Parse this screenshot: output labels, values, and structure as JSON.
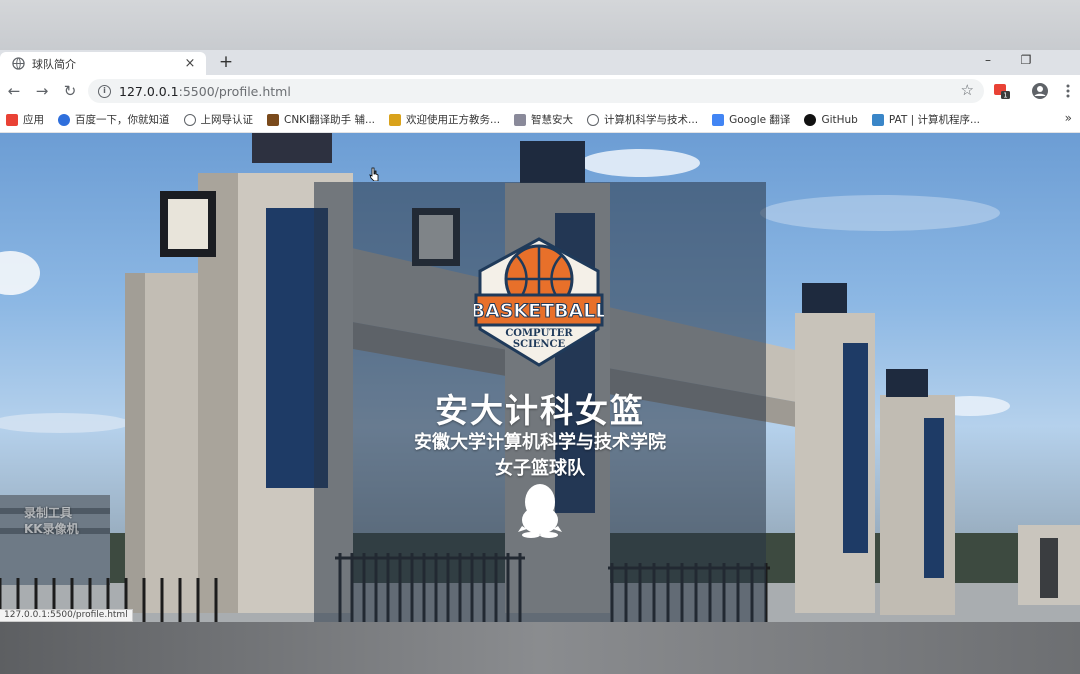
{
  "tab": {
    "title": "球队简介",
    "close": "×"
  },
  "newtab": "+",
  "window": {
    "minimize": "–",
    "restore": "❐"
  },
  "toolbar": {
    "back": "←",
    "forward": "→",
    "reload": "↻",
    "url_host": "127.0.0.1",
    "url_path": ":5500/profile.html",
    "star": "☆"
  },
  "bookmarks": [
    {
      "label": "应用",
      "icon": "apps-grid-icon",
      "color": "#e94235"
    },
    {
      "label": "百度一下，你就知道",
      "icon": "baidu-paw-icon",
      "color": "#2f6fdc"
    },
    {
      "label": "上网导认证",
      "icon": "globe-icon",
      "color": "#5f6368"
    },
    {
      "label": "CNKI翻译助手 辅...",
      "icon": "cnki-icon",
      "color": "#7a4a1c"
    },
    {
      "label": "欢迎使用正方教务...",
      "icon": "zf-icon",
      "color": "#d9a21b"
    },
    {
      "label": "智慧安大",
      "icon": "ahu-icon",
      "color": "#8a8a9a"
    },
    {
      "label": "计算机科学与技术...",
      "icon": "globe-icon",
      "color": "#5f6368"
    },
    {
      "label": "Google 翻译",
      "icon": "google-translate-icon",
      "color": "#4285f4"
    },
    {
      "label": "GitHub",
      "icon": "github-icon",
      "color": "#111111"
    },
    {
      "label": "PAT | 计算机程序...",
      "icon": "pat-icon",
      "color": "#3a86c8"
    }
  ],
  "bookmarks_more": "»",
  "hero": {
    "logo_word": "BASKETBALL",
    "logo_sub1": "COMPUTER",
    "logo_sub2": "SCIENCE",
    "headline": "安大计科女篮",
    "subline1": "安徽大学计算机科学与技术学院",
    "subline2": "女子篮球队",
    "qq_icon": "qq-penguin-icon"
  },
  "watermark": {
    "line1": "录制工具",
    "line2": "KK录像机"
  },
  "statusbar": "127.0.0.1:5500/profile.html",
  "colors": {
    "accent_orange": "#e8702a",
    "badge_red": "#e94235",
    "logo_navy": "#1f3a5a"
  }
}
